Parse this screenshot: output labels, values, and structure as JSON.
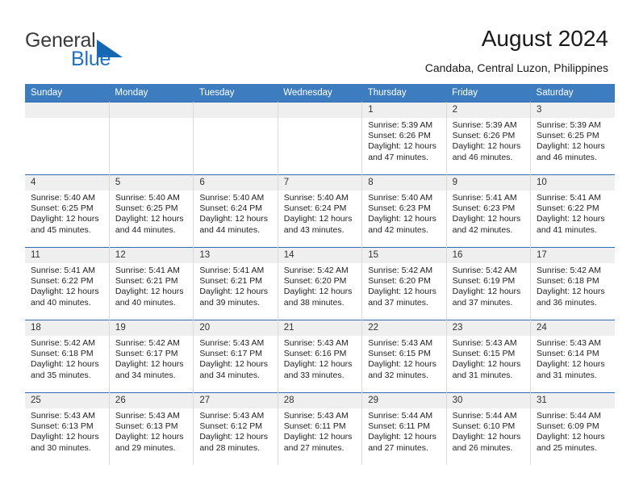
{
  "brand": {
    "name_top": "General",
    "name_bottom": "Blue",
    "accent_color": "#1567b2",
    "text_color": "#3b3b3b"
  },
  "header": {
    "title": "August 2024",
    "location": "Candaba, Central Luzon, Philippines"
  },
  "theme": {
    "header_bg": "#3d7dbf",
    "row_border": "#2f6eb5",
    "daynum_bg": "#efefef"
  },
  "calendar": {
    "weekday_headers": [
      "Sunday",
      "Monday",
      "Tuesday",
      "Wednesday",
      "Thursday",
      "Friday",
      "Saturday"
    ],
    "labels": {
      "sunrise": "Sunrise:",
      "sunset": "Sunset:",
      "daylight": "Daylight:"
    },
    "weeks": [
      [
        {
          "day": "",
          "empty": true
        },
        {
          "day": "",
          "empty": true
        },
        {
          "day": "",
          "empty": true
        },
        {
          "day": "",
          "empty": true
        },
        {
          "day": "1",
          "sunrise": "Sunrise: 5:39 AM",
          "sunset": "Sunset: 6:26 PM",
          "daylight_1": "Daylight: 12 hours",
          "daylight_2": "and 47 minutes."
        },
        {
          "day": "2",
          "sunrise": "Sunrise: 5:39 AM",
          "sunset": "Sunset: 6:26 PM",
          "daylight_1": "Daylight: 12 hours",
          "daylight_2": "and 46 minutes."
        },
        {
          "day": "3",
          "sunrise": "Sunrise: 5:39 AM",
          "sunset": "Sunset: 6:25 PM",
          "daylight_1": "Daylight: 12 hours",
          "daylight_2": "and 46 minutes."
        }
      ],
      [
        {
          "day": "4",
          "sunrise": "Sunrise: 5:40 AM",
          "sunset": "Sunset: 6:25 PM",
          "daylight_1": "Daylight: 12 hours",
          "daylight_2": "and 45 minutes."
        },
        {
          "day": "5",
          "sunrise": "Sunrise: 5:40 AM",
          "sunset": "Sunset: 6:25 PM",
          "daylight_1": "Daylight: 12 hours",
          "daylight_2": "and 44 minutes."
        },
        {
          "day": "6",
          "sunrise": "Sunrise: 5:40 AM",
          "sunset": "Sunset: 6:24 PM",
          "daylight_1": "Daylight: 12 hours",
          "daylight_2": "and 44 minutes."
        },
        {
          "day": "7",
          "sunrise": "Sunrise: 5:40 AM",
          "sunset": "Sunset: 6:24 PM",
          "daylight_1": "Daylight: 12 hours",
          "daylight_2": "and 43 minutes."
        },
        {
          "day": "8",
          "sunrise": "Sunrise: 5:40 AM",
          "sunset": "Sunset: 6:23 PM",
          "daylight_1": "Daylight: 12 hours",
          "daylight_2": "and 42 minutes."
        },
        {
          "day": "9",
          "sunrise": "Sunrise: 5:41 AM",
          "sunset": "Sunset: 6:23 PM",
          "daylight_1": "Daylight: 12 hours",
          "daylight_2": "and 42 minutes."
        },
        {
          "day": "10",
          "sunrise": "Sunrise: 5:41 AM",
          "sunset": "Sunset: 6:22 PM",
          "daylight_1": "Daylight: 12 hours",
          "daylight_2": "and 41 minutes."
        }
      ],
      [
        {
          "day": "11",
          "sunrise": "Sunrise: 5:41 AM",
          "sunset": "Sunset: 6:22 PM",
          "daylight_1": "Daylight: 12 hours",
          "daylight_2": "and 40 minutes."
        },
        {
          "day": "12",
          "sunrise": "Sunrise: 5:41 AM",
          "sunset": "Sunset: 6:21 PM",
          "daylight_1": "Daylight: 12 hours",
          "daylight_2": "and 40 minutes."
        },
        {
          "day": "13",
          "sunrise": "Sunrise: 5:41 AM",
          "sunset": "Sunset: 6:21 PM",
          "daylight_1": "Daylight: 12 hours",
          "daylight_2": "and 39 minutes."
        },
        {
          "day": "14",
          "sunrise": "Sunrise: 5:42 AM",
          "sunset": "Sunset: 6:20 PM",
          "daylight_1": "Daylight: 12 hours",
          "daylight_2": "and 38 minutes."
        },
        {
          "day": "15",
          "sunrise": "Sunrise: 5:42 AM",
          "sunset": "Sunset: 6:20 PM",
          "daylight_1": "Daylight: 12 hours",
          "daylight_2": "and 37 minutes."
        },
        {
          "day": "16",
          "sunrise": "Sunrise: 5:42 AM",
          "sunset": "Sunset: 6:19 PM",
          "daylight_1": "Daylight: 12 hours",
          "daylight_2": "and 37 minutes."
        },
        {
          "day": "17",
          "sunrise": "Sunrise: 5:42 AM",
          "sunset": "Sunset: 6:18 PM",
          "daylight_1": "Daylight: 12 hours",
          "daylight_2": "and 36 minutes."
        }
      ],
      [
        {
          "day": "18",
          "sunrise": "Sunrise: 5:42 AM",
          "sunset": "Sunset: 6:18 PM",
          "daylight_1": "Daylight: 12 hours",
          "daylight_2": "and 35 minutes."
        },
        {
          "day": "19",
          "sunrise": "Sunrise: 5:42 AM",
          "sunset": "Sunset: 6:17 PM",
          "daylight_1": "Daylight: 12 hours",
          "daylight_2": "and 34 minutes."
        },
        {
          "day": "20",
          "sunrise": "Sunrise: 5:43 AM",
          "sunset": "Sunset: 6:17 PM",
          "daylight_1": "Daylight: 12 hours",
          "daylight_2": "and 34 minutes."
        },
        {
          "day": "21",
          "sunrise": "Sunrise: 5:43 AM",
          "sunset": "Sunset: 6:16 PM",
          "daylight_1": "Daylight: 12 hours",
          "daylight_2": "and 33 minutes."
        },
        {
          "day": "22",
          "sunrise": "Sunrise: 5:43 AM",
          "sunset": "Sunset: 6:15 PM",
          "daylight_1": "Daylight: 12 hours",
          "daylight_2": "and 32 minutes."
        },
        {
          "day": "23",
          "sunrise": "Sunrise: 5:43 AM",
          "sunset": "Sunset: 6:15 PM",
          "daylight_1": "Daylight: 12 hours",
          "daylight_2": "and 31 minutes."
        },
        {
          "day": "24",
          "sunrise": "Sunrise: 5:43 AM",
          "sunset": "Sunset: 6:14 PM",
          "daylight_1": "Daylight: 12 hours",
          "daylight_2": "and 31 minutes."
        }
      ],
      [
        {
          "day": "25",
          "sunrise": "Sunrise: 5:43 AM",
          "sunset": "Sunset: 6:13 PM",
          "daylight_1": "Daylight: 12 hours",
          "daylight_2": "and 30 minutes."
        },
        {
          "day": "26",
          "sunrise": "Sunrise: 5:43 AM",
          "sunset": "Sunset: 6:13 PM",
          "daylight_1": "Daylight: 12 hours",
          "daylight_2": "and 29 minutes."
        },
        {
          "day": "27",
          "sunrise": "Sunrise: 5:43 AM",
          "sunset": "Sunset: 6:12 PM",
          "daylight_1": "Daylight: 12 hours",
          "daylight_2": "and 28 minutes."
        },
        {
          "day": "28",
          "sunrise": "Sunrise: 5:43 AM",
          "sunset": "Sunset: 6:11 PM",
          "daylight_1": "Daylight: 12 hours",
          "daylight_2": "and 27 minutes."
        },
        {
          "day": "29",
          "sunrise": "Sunrise: 5:44 AM",
          "sunset": "Sunset: 6:11 PM",
          "daylight_1": "Daylight: 12 hours",
          "daylight_2": "and 27 minutes."
        },
        {
          "day": "30",
          "sunrise": "Sunrise: 5:44 AM",
          "sunset": "Sunset: 6:10 PM",
          "daylight_1": "Daylight: 12 hours",
          "daylight_2": "and 26 minutes."
        },
        {
          "day": "31",
          "sunrise": "Sunrise: 5:44 AM",
          "sunset": "Sunset: 6:09 PM",
          "daylight_1": "Daylight: 12 hours",
          "daylight_2": "and 25 minutes."
        }
      ]
    ]
  }
}
